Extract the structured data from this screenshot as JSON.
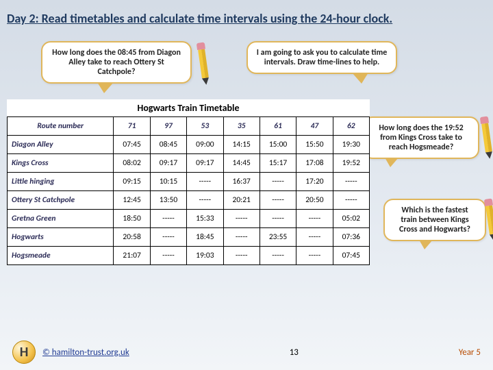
{
  "title": "Day 2: Read timetables and calculate time intervals using the 24-hour clock.",
  "bubbles": {
    "b1": "How long does the 08:45 from Diagon Alley take to reach Ottery St Catchpole?",
    "b2": "I am going to ask you to calculate time intervals.\nDraw time-lines to help.",
    "b3": "How long does the 19:52 from Kings Cross take to reach Hogsmeade?",
    "b4": "Which is the fastest train between Kings Cross and Hogwarts?"
  },
  "timetable_title": "Hogwarts Train Timetable",
  "route_header": "Route number",
  "routes": [
    "71",
    "97",
    "53",
    "35",
    "61",
    "47",
    "62"
  ],
  "stations": [
    "Diagon Alley",
    "Kings Cross",
    "Little hinging",
    "Ottery St Catchpole",
    "Gretna Green",
    "Hogwarts",
    "Hogsmeade"
  ],
  "times": [
    [
      "07:45",
      "08:45",
      "09:00",
      "14:15",
      "15:00",
      "15:50",
      "19:30"
    ],
    [
      "08:02",
      "09:17",
      "09:17",
      "14:45",
      "15:17",
      "17:08",
      "19:52"
    ],
    [
      "09:15",
      "10:15",
      "-----",
      "16:37",
      "-----",
      "17:20",
      "-----"
    ],
    [
      "12:45",
      "13:50",
      "-----",
      "20:21",
      "-----",
      "20:50",
      "-----"
    ],
    [
      "18:50",
      "-----",
      "15:33",
      "-----",
      "-----",
      "-----",
      "05:02"
    ],
    [
      "20:58",
      "-----",
      "18:45",
      "-----",
      "23:55",
      "-----",
      "07:36"
    ],
    [
      "21:07",
      "-----",
      "19:03",
      "-----",
      "-----",
      "-----",
      "07:45"
    ]
  ],
  "footer": {
    "link": "© hamilton-trust.org.uk",
    "page": "13",
    "year": "Year 5"
  },
  "chart_data": {
    "type": "table",
    "title": "Hogwarts Train Timetable",
    "columns": [
      "Route number",
      "71",
      "97",
      "53",
      "35",
      "61",
      "47",
      "62"
    ],
    "rows": [
      [
        "Diagon Alley",
        "07:45",
        "08:45",
        "09:00",
        "14:15",
        "15:00",
        "15:50",
        "19:30"
      ],
      [
        "Kings Cross",
        "08:02",
        "09:17",
        "09:17",
        "14:45",
        "15:17",
        "17:08",
        "19:52"
      ],
      [
        "Little hinging",
        "09:15",
        "10:15",
        "-----",
        "16:37",
        "-----",
        "17:20",
        "-----"
      ],
      [
        "Ottery St Catchpole",
        "12:45",
        "13:50",
        "-----",
        "20:21",
        "-----",
        "20:50",
        "-----"
      ],
      [
        "Gretna Green",
        "18:50",
        "-----",
        "15:33",
        "-----",
        "-----",
        "-----",
        "05:02"
      ],
      [
        "Hogwarts",
        "20:58",
        "-----",
        "18:45",
        "-----",
        "23:55",
        "-----",
        "07:36"
      ],
      [
        "Hogsmeade",
        "21:07",
        "-----",
        "19:03",
        "-----",
        "-----",
        "-----",
        "07:45"
      ]
    ]
  }
}
